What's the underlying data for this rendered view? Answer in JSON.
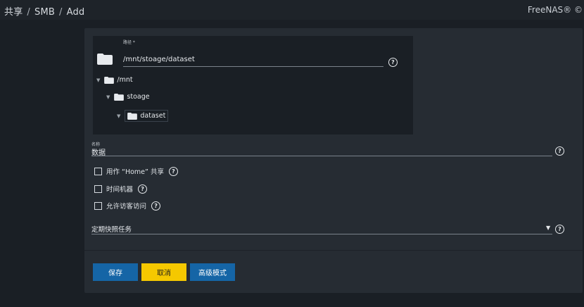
{
  "breadcrumb": {
    "part1": "共享",
    "sep": "/",
    "part2": "SMB",
    "part3": "Add"
  },
  "brand": "FreeNAS® ©",
  "explorer": {
    "path_label": "路径 *",
    "path_value": "/mnt/stoage/dataset",
    "tree": [
      {
        "label": "/mnt"
      },
      {
        "label": "stoage"
      },
      {
        "label": "dataset"
      }
    ]
  },
  "name_field": {
    "label": "名称",
    "value": "数据"
  },
  "checkboxes": [
    {
      "label": "用作 “Home” 共享",
      "checked": false
    },
    {
      "label": "时间机器",
      "checked": false
    },
    {
      "label": "允许访客访问",
      "checked": false
    }
  ],
  "snapshot_field": {
    "label": "定期快照任务",
    "value": ""
  },
  "buttons": {
    "save": "保存",
    "cancel": "取消",
    "advanced": "高级模式"
  },
  "colors": {
    "primary": "#1565a6",
    "warning": "#f5c800",
    "card": "#262c33",
    "background": "#1a1f25"
  },
  "icons": {
    "help": "?"
  }
}
